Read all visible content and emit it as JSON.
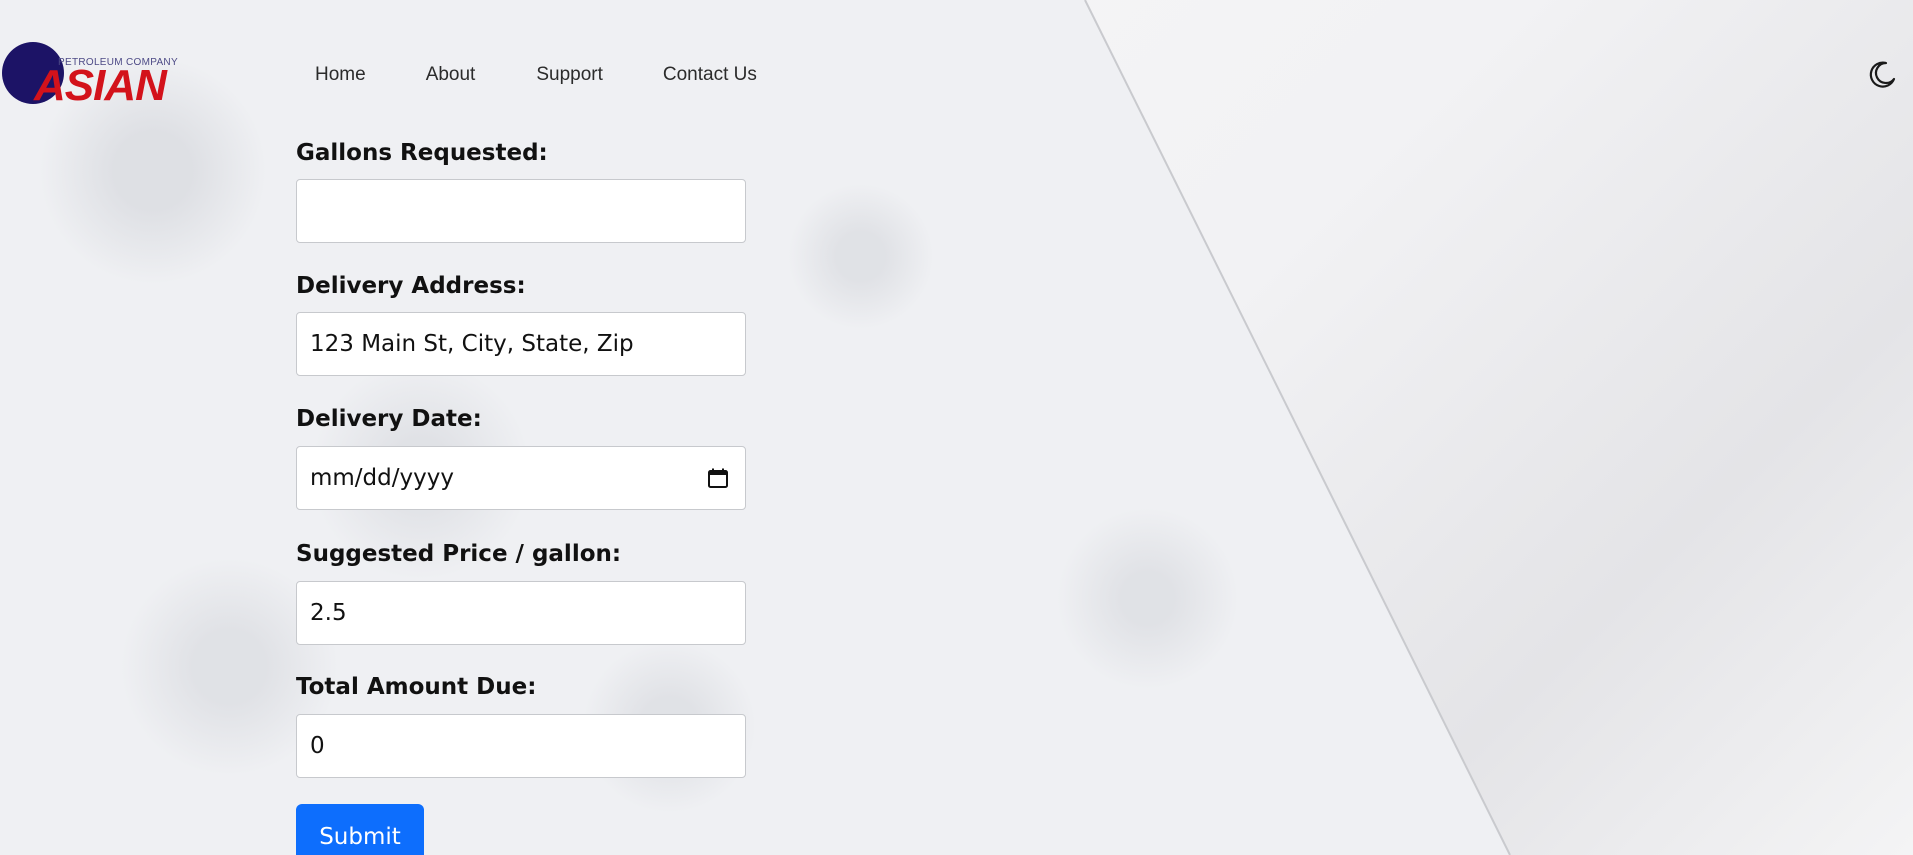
{
  "brand": {
    "subtitle": "PETROLEUM COMPANY",
    "name": "ASIAN",
    "colors": {
      "circle": "#1c1366",
      "text": "#d3121b"
    }
  },
  "nav": {
    "items": [
      {
        "label": "Home"
      },
      {
        "label": "About"
      },
      {
        "label": "Support"
      },
      {
        "label": "Contact Us"
      }
    ]
  },
  "theme_toggle": {
    "icon": "moon-icon"
  },
  "form": {
    "gallons": {
      "label": "Gallons Requested:",
      "value": ""
    },
    "address": {
      "label": "Delivery Address:",
      "value": "123 Main St, City, State, Zip"
    },
    "date": {
      "label": "Delivery Date:",
      "value": "mm/dd/yyyy",
      "icon": "calendar-icon"
    },
    "price": {
      "label": "Suggested Price / gallon:",
      "value": "2.5"
    },
    "total": {
      "label": "Total Amount Due:",
      "value": "0"
    },
    "submit_label": "Submit"
  },
  "colors": {
    "primary": "#0d6efd",
    "background": "#eff0f3"
  }
}
